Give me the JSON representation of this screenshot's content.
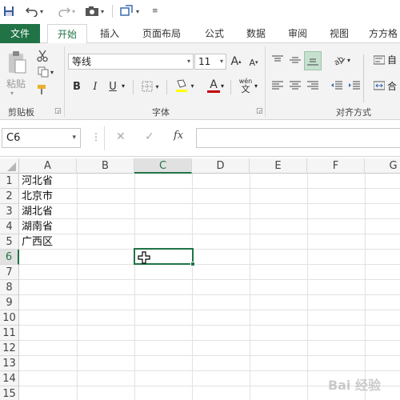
{
  "quick_access": {
    "save_icon": "save-icon",
    "undo_icon": "undo-icon",
    "redo_icon": "redo-icon",
    "camera_icon": "camera-icon",
    "shape_icon": "shape-icon"
  },
  "tabs": [
    {
      "label": "文件"
    },
    {
      "label": "开始"
    },
    {
      "label": "插入"
    },
    {
      "label": "页面布局"
    },
    {
      "label": "公式"
    },
    {
      "label": "数据"
    },
    {
      "label": "审阅"
    },
    {
      "label": "视图"
    },
    {
      "label": "方方格"
    }
  ],
  "ribbon": {
    "clipboard": {
      "paste_label": "粘贴",
      "group_label": "剪贴板"
    },
    "font": {
      "font_name": "等线",
      "font_size": "11",
      "bold": "B",
      "italic": "I",
      "underline": "U",
      "grow": "A",
      "shrink": "A",
      "font_color_glyph": "A",
      "wen_glyph": "wén",
      "wen_char": "文",
      "group_label": "字体",
      "highlight_color": "#ffff00",
      "font_color": "#c00000"
    },
    "align": {
      "wrap_label": "自",
      "merge_label": "合",
      "group_label": "对齐方式"
    }
  },
  "formula_bar": {
    "name_box": "C6",
    "cancel_icon": "✕",
    "enter_icon": "✓",
    "fx_label": "fx"
  },
  "grid": {
    "columns": [
      "A",
      "B",
      "C",
      "D",
      "E",
      "F",
      "G"
    ],
    "selected_column": "C",
    "rows": [
      "1",
      "2",
      "3",
      "4",
      "5",
      "6",
      "7",
      "8",
      "9",
      "10",
      "11",
      "12",
      "13",
      "14",
      "15"
    ],
    "selected_row": "6",
    "cells": [
      "河北省",
      "北京市",
      "湖北省",
      "湖南省",
      "广西区"
    ],
    "active_cell": "C6"
  },
  "watermark": "Bai 经验",
  "colors": {
    "accent": "#217346"
  }
}
